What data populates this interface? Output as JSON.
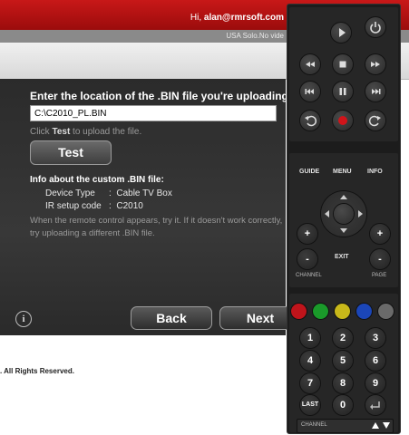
{
  "header": {
    "greeting_prefix": "Hi, ",
    "user_email": "alan@rmrsoft.com",
    "subtitle": "USA Solo.No vide"
  },
  "panel": {
    "heading": "Enter the location of the .BIN file you're uploading:",
    "file_path_value": "C:\\C2010_PL.BIN",
    "hint_prefix": "Click ",
    "hint_bold": "Test",
    "hint_suffix": " to upload the file.",
    "test_label": "Test",
    "info_heading": "Info about the custom .BIN file:",
    "info_rows": [
      {
        "key": "Device Type",
        "sep": ":",
        "value": "Cable TV Box"
      },
      {
        "key": "IR setup code",
        "sep": ":",
        "value": "C2010"
      }
    ],
    "note": "When the remote control appears, try it. If it doesn't work correctly, try uploading a different .BIN file.",
    "back_label": "Back",
    "next_label": "Next"
  },
  "footer": {
    "rights": ". All Rights Reserved."
  },
  "remote": {
    "guide": "GUIDE",
    "menu": "MENU",
    "info": "INFO",
    "exit": "EXIT",
    "channel": "CHANNEL",
    "page": "PAGE",
    "last": "LAST",
    "channel_bottom": "CHANNEL",
    "plus": "+",
    "minus": "-",
    "digits": [
      "1",
      "2",
      "3",
      "4",
      "5",
      "6",
      "7",
      "8",
      "9",
      "0"
    ],
    "colors": {
      "red": "#c0141b",
      "green": "#1a9a2a",
      "yellow": "#c8b81a",
      "blue": "#1b46b8",
      "grey": "#6a6a6a"
    }
  },
  "theme": {
    "header_red": "#b31212",
    "panel_dark": "#333333"
  }
}
